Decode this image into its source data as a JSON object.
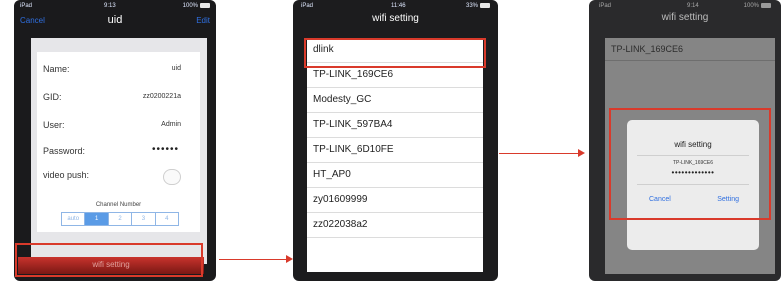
{
  "colors": {
    "highlight": "#d93a2b",
    "ios_blue": "#2f6fe0",
    "red_button": "#c9332d"
  },
  "screen1": {
    "status": {
      "carrier": "iPad",
      "time": "9:13",
      "battery": "100%"
    },
    "nav": {
      "cancel": "Cancel",
      "title": "uid",
      "edit": "Edit"
    },
    "fields": [
      {
        "label": "Name:",
        "value": "uid"
      },
      {
        "label": "GID:",
        "value": "zz0200221a"
      },
      {
        "label": "User:",
        "value": "Admin"
      },
      {
        "label": "Password:",
        "value": "••••••"
      }
    ],
    "video_push_label": "video push:",
    "channel_title": "Channel Number",
    "channels": [
      "auto",
      "1",
      "2",
      "3",
      "4"
    ],
    "bottom_button": "wifi setting"
  },
  "screen2": {
    "status": {
      "carrier": "iPad",
      "time": "11:46",
      "battery": "33%"
    },
    "title": "wifi setting",
    "networks": [
      "dlink",
      "TP-LINK_169CE6",
      "Modesty_GC",
      "TP-LINK_597BA4",
      "TP-LINK_6D10FE",
      "HT_AP0",
      "zy01609999",
      "zz022038a2"
    ]
  },
  "screen3": {
    "status": {
      "carrier": "iPad",
      "time": "9:14",
      "battery": "100%"
    },
    "title": "wifi setting",
    "first_network": "TP-LINK_169CE6",
    "dialog": {
      "title": "wifi setting",
      "network": "TP-LINK_169CE6",
      "password": "•••••••••••••",
      "cancel": "Cancel",
      "confirm": "Setting"
    }
  }
}
